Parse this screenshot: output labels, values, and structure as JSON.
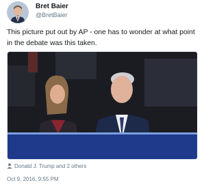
{
  "tweet": {
    "author_name": "Bret Baier",
    "author_handle": "@BretBaier",
    "text": "This picture put out by AP - one has to wonder at what point in the debate was this taken.",
    "retweeted_by": "Donald J. Trump and 2 others",
    "timestamp": "Oct 9, 2016, 9:55 PM"
  },
  "icons": {
    "avatar": "profile-photo",
    "retweeted_by": "user-icon",
    "media": "debate-audience-photo"
  },
  "colors": {
    "text": "#14171a",
    "secondary_text": "#657786",
    "border": "#e1e8ed"
  }
}
